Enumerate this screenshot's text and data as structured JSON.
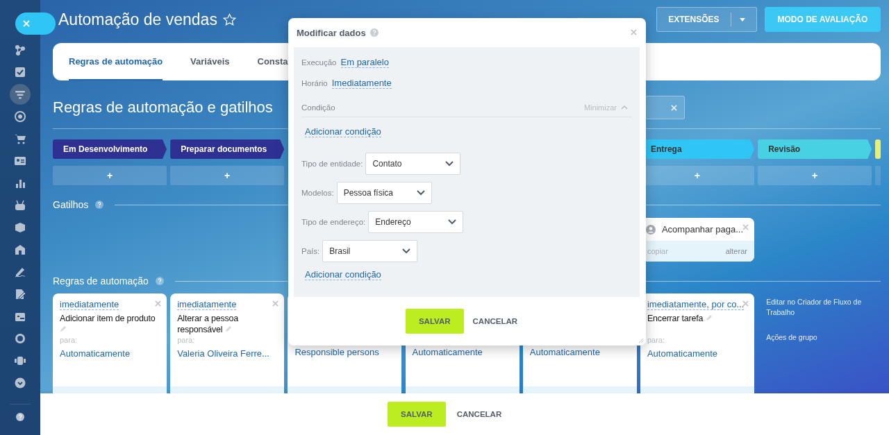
{
  "sidebar": {
    "items": [
      {
        "kind": "nodes",
        "selected": false
      },
      {
        "kind": "task",
        "selected": false
      },
      {
        "kind": "funnel",
        "selected": true
      },
      {
        "kind": "target",
        "selected": false
      },
      {
        "kind": "cart",
        "selected": false
      },
      {
        "kind": "contact",
        "selected": false
      },
      {
        "kind": "chart",
        "selected": false
      },
      {
        "kind": "robot",
        "selected": false
      },
      {
        "kind": "box",
        "selected": false
      },
      {
        "kind": "store",
        "selected": false
      },
      {
        "kind": "sign",
        "selected": false
      },
      {
        "kind": "edit",
        "selected": false
      },
      {
        "kind": "calendar",
        "selected": false
      },
      {
        "kind": "circle",
        "selected": false
      },
      {
        "kind": "team",
        "selected": false
      },
      {
        "kind": "more",
        "selected": false
      }
    ]
  },
  "header": {
    "title": "Automação de vendas",
    "favorite": false,
    "buttons": [
      {
        "label": "EXTENSÕES",
        "kind": "split"
      },
      {
        "label": "MODO DE AVALIAÇÃO",
        "kind": "primary"
      }
    ]
  },
  "tabs": [
    {
      "label": "Regras de automação",
      "selected": true
    },
    {
      "label": "Variáveis",
      "selected": false
    },
    {
      "label": "Consta",
      "selected": false
    }
  ],
  "section_title": "Regras de automação e gatilhos",
  "stages_left": [
    {
      "name": "Em Desenvolvimento",
      "color": "#2e3192",
      "add": "+"
    },
    {
      "name": "Preparar documentos",
      "color": "#2e3192",
      "add": "+"
    }
  ],
  "stages_right": [
    {
      "name": "Entrega",
      "color": "#2fc6f6",
      "add": "+"
    },
    {
      "name": "Revisão",
      "color": "#47d1e2",
      "add": "+"
    },
    {
      "color": "#e3f17a"
    }
  ],
  "triggers": {
    "title": "Gatilhos",
    "cards": [
      {
        "title": "Acompanhar paga...",
        "copy": "copiar",
        "edit": "alterar"
      }
    ]
  },
  "rules": {
    "title": "Regras de automação",
    "cards_left": [
      {
        "timing": "imediatamente",
        "title": "Adicionar item de produto",
        "for": "para:",
        "performer": "Automaticamente"
      },
      {
        "timing": "imediatamente",
        "title": "Alterar a pessoa responsável",
        "for": "para:",
        "performer": "Valeria Oliveira Ferre..."
      }
    ],
    "cards_middle": [
      {
        "performer": "Responsible persons"
      },
      {
        "performer": "Automaticamente"
      },
      {
        "performer": "Automaticamente"
      }
    ],
    "cards_right": [
      {
        "timing": "imediatamente, por co...",
        "title": "Encerrar tarefa",
        "for": "para:",
        "performer": "Automaticamente"
      }
    ]
  },
  "side_links": [
    "Editar no Criador de Fluxo de Trabalho",
    "Ações de grupo"
  ],
  "footer": {
    "buttons": [
      {
        "label": "SALVAR",
        "kind": "primary"
      },
      {
        "label": "CANCELAR",
        "kind": "link"
      }
    ]
  },
  "dialog": {
    "title": "Modificar dados",
    "settings": [
      {
        "label": "Execução",
        "value": "Em paralelo"
      },
      {
        "label": "Horário",
        "value": "Imediatamente"
      }
    ],
    "condition": {
      "label": "Condição",
      "toggle": "Minimizar",
      "expanded": true
    },
    "add_condition": "Adicionar condição",
    "fields": [
      {
        "label": "Tipo de entidade:",
        "value": "Contato"
      },
      {
        "label": "Modelos:",
        "value": "Pessoa física"
      },
      {
        "label": "Tipo de endereço:",
        "value": "Endereço"
      },
      {
        "label": "País:",
        "value": "Brasil"
      }
    ],
    "add_condition_bottom": "Adicionar condição",
    "buttons": [
      {
        "label": "SALVAR",
        "kind": "primary"
      },
      {
        "label": "CANCELAR",
        "kind": "link"
      }
    ]
  }
}
